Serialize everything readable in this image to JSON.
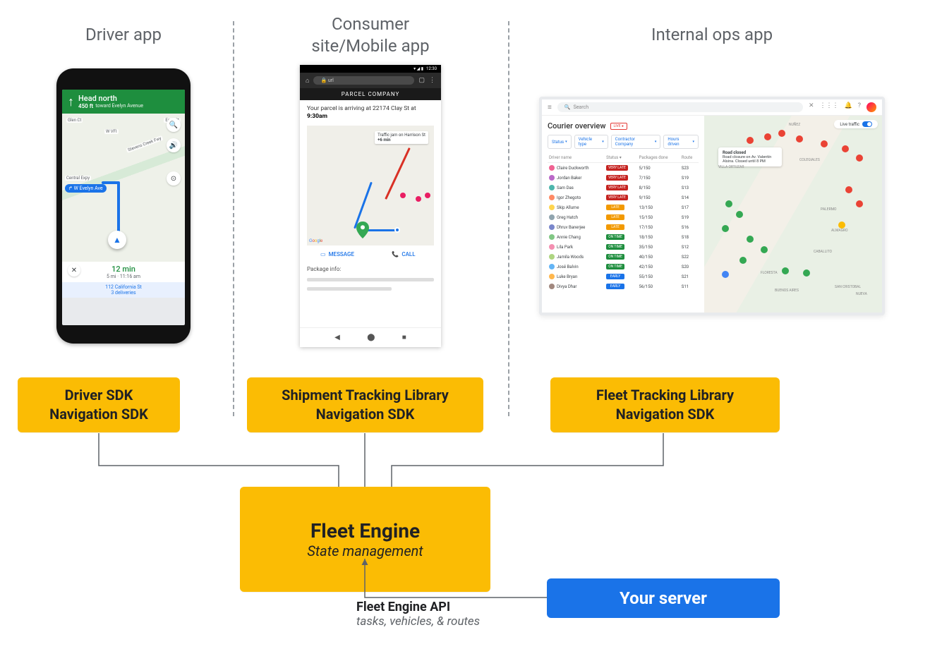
{
  "columns": {
    "driver": {
      "title": "Driver app",
      "sdk": "Driver SDK\nNavigation SDK"
    },
    "consumer": {
      "title": "Consumer\nsite/Mobile app",
      "sdk": "Shipment Tracking Library\nNavigation SDK"
    },
    "ops": {
      "title": "Internal ops app",
      "sdk": "Fleet Tracking Library\nNavigation SDK"
    }
  },
  "fleet_engine": {
    "title": "Fleet Engine",
    "subtitle": "State management"
  },
  "server": {
    "label": "Your server"
  },
  "api_label": {
    "main": "Fleet Engine API",
    "sub": "tasks, vehicles, & routes"
  },
  "driver_app": {
    "direction_main": "Head north",
    "direction_sub": "toward Evelyn Avenue",
    "distance": "450 ft",
    "street_chip": "↱ W Evelyn Ave",
    "labels": [
      "Glen Ct",
      "Stevens Creek Fwy",
      "Central Expy",
      "Easy St",
      "W VFI"
    ],
    "eta_time": "12 min",
    "eta_sub": "5 mi · 11:16 am",
    "deliveries_addr": "112 California St",
    "deliveries_count": "3 deliveries"
  },
  "consumer_app": {
    "status_time": "12:30",
    "url_text": "url",
    "company": "PARCEL COMPANY",
    "parcel_msg_prefix": "Your parcel is arriving at 22174 Clay St at ",
    "parcel_time": "9:30am",
    "traffic_msg_line1": "Traffic jam on Harrison St",
    "traffic_msg_line2": "+6 min",
    "actions": {
      "message": "MESSAGE",
      "call": "CALL"
    },
    "pkg_info": "Package info:"
  },
  "ops_app": {
    "search_placeholder": "Search",
    "title": "Courier overview",
    "live": "LIVE ●",
    "filters": [
      "Status",
      "Vehicle type",
      "Contractor Company",
      "Hours driven"
    ],
    "live_traffic": "Live traffic",
    "columns": [
      "Driver name",
      "Status",
      "Packages done",
      "Route"
    ],
    "popup_title": "Road closed",
    "popup_body": "Road closure on Av. Valentín Alsina. Closed until 8 PM",
    "map_areas": [
      "NUÑEZ",
      "COLEGIALES",
      "VILLA ORTUZAR",
      "PALERMO",
      "ALMAGRO",
      "CABALLITO",
      "FLORESTA",
      "BUENOS AIRES",
      "SAN CRISTOBAL",
      "NUEVA"
    ],
    "rows": [
      {
        "name": "Claire Duckworth",
        "status": "VERY LATE",
        "cls": "very-late",
        "pkg": "5/150",
        "route": "S23",
        "color": "#f06292"
      },
      {
        "name": "Jordan Baker",
        "status": "VERY LATE",
        "cls": "very-late",
        "pkg": "7/150",
        "route": "S19",
        "color": "#ba68c8"
      },
      {
        "name": "Sam Das",
        "status": "VERY LATE",
        "cls": "very-late",
        "pkg": "8/150",
        "route": "S13",
        "color": "#4db6ac"
      },
      {
        "name": "Igor Zhegoto",
        "status": "VERY LATE",
        "cls": "very-late",
        "pkg": "9/150",
        "route": "S14",
        "color": "#ff8a65"
      },
      {
        "name": "Skip Allume",
        "status": "LATE",
        "cls": "late",
        "pkg": "13/150",
        "route": "S17",
        "color": "#ffd54f"
      },
      {
        "name": "Greg Hatch",
        "status": "LATE",
        "cls": "late",
        "pkg": "15/150",
        "route": "S19",
        "color": "#90a4ae"
      },
      {
        "name": "Dhruv Banerjee",
        "status": "LATE",
        "cls": "late",
        "pkg": "17/150",
        "route": "S16",
        "color": "#7986cb"
      },
      {
        "name": "Annie Chang",
        "status": "ON TIME",
        "cls": "on-time",
        "pkg": "18/150",
        "route": "S18",
        "color": "#81c784"
      },
      {
        "name": "Lila Park",
        "status": "ON TIME",
        "cls": "on-time",
        "pkg": "35/150",
        "route": "S12",
        "color": "#f48fb1"
      },
      {
        "name": "Jamila Woods",
        "status": "ON TIME",
        "cls": "on-time",
        "pkg": "40/150",
        "route": "S22",
        "color": "#aed581"
      },
      {
        "name": "José Balvin",
        "status": "ON TIME",
        "cls": "on-time",
        "pkg": "42/150",
        "route": "S20",
        "color": "#64b5f6"
      },
      {
        "name": "Luke Bryan",
        "status": "EARLY",
        "cls": "early",
        "pkg": "55/150",
        "route": "S21",
        "color": "#ffb74d"
      },
      {
        "name": "Divya Dhar",
        "status": "EARLY",
        "cls": "early",
        "pkg": "56/150",
        "route": "S11",
        "color": "#a1887f"
      }
    ]
  }
}
